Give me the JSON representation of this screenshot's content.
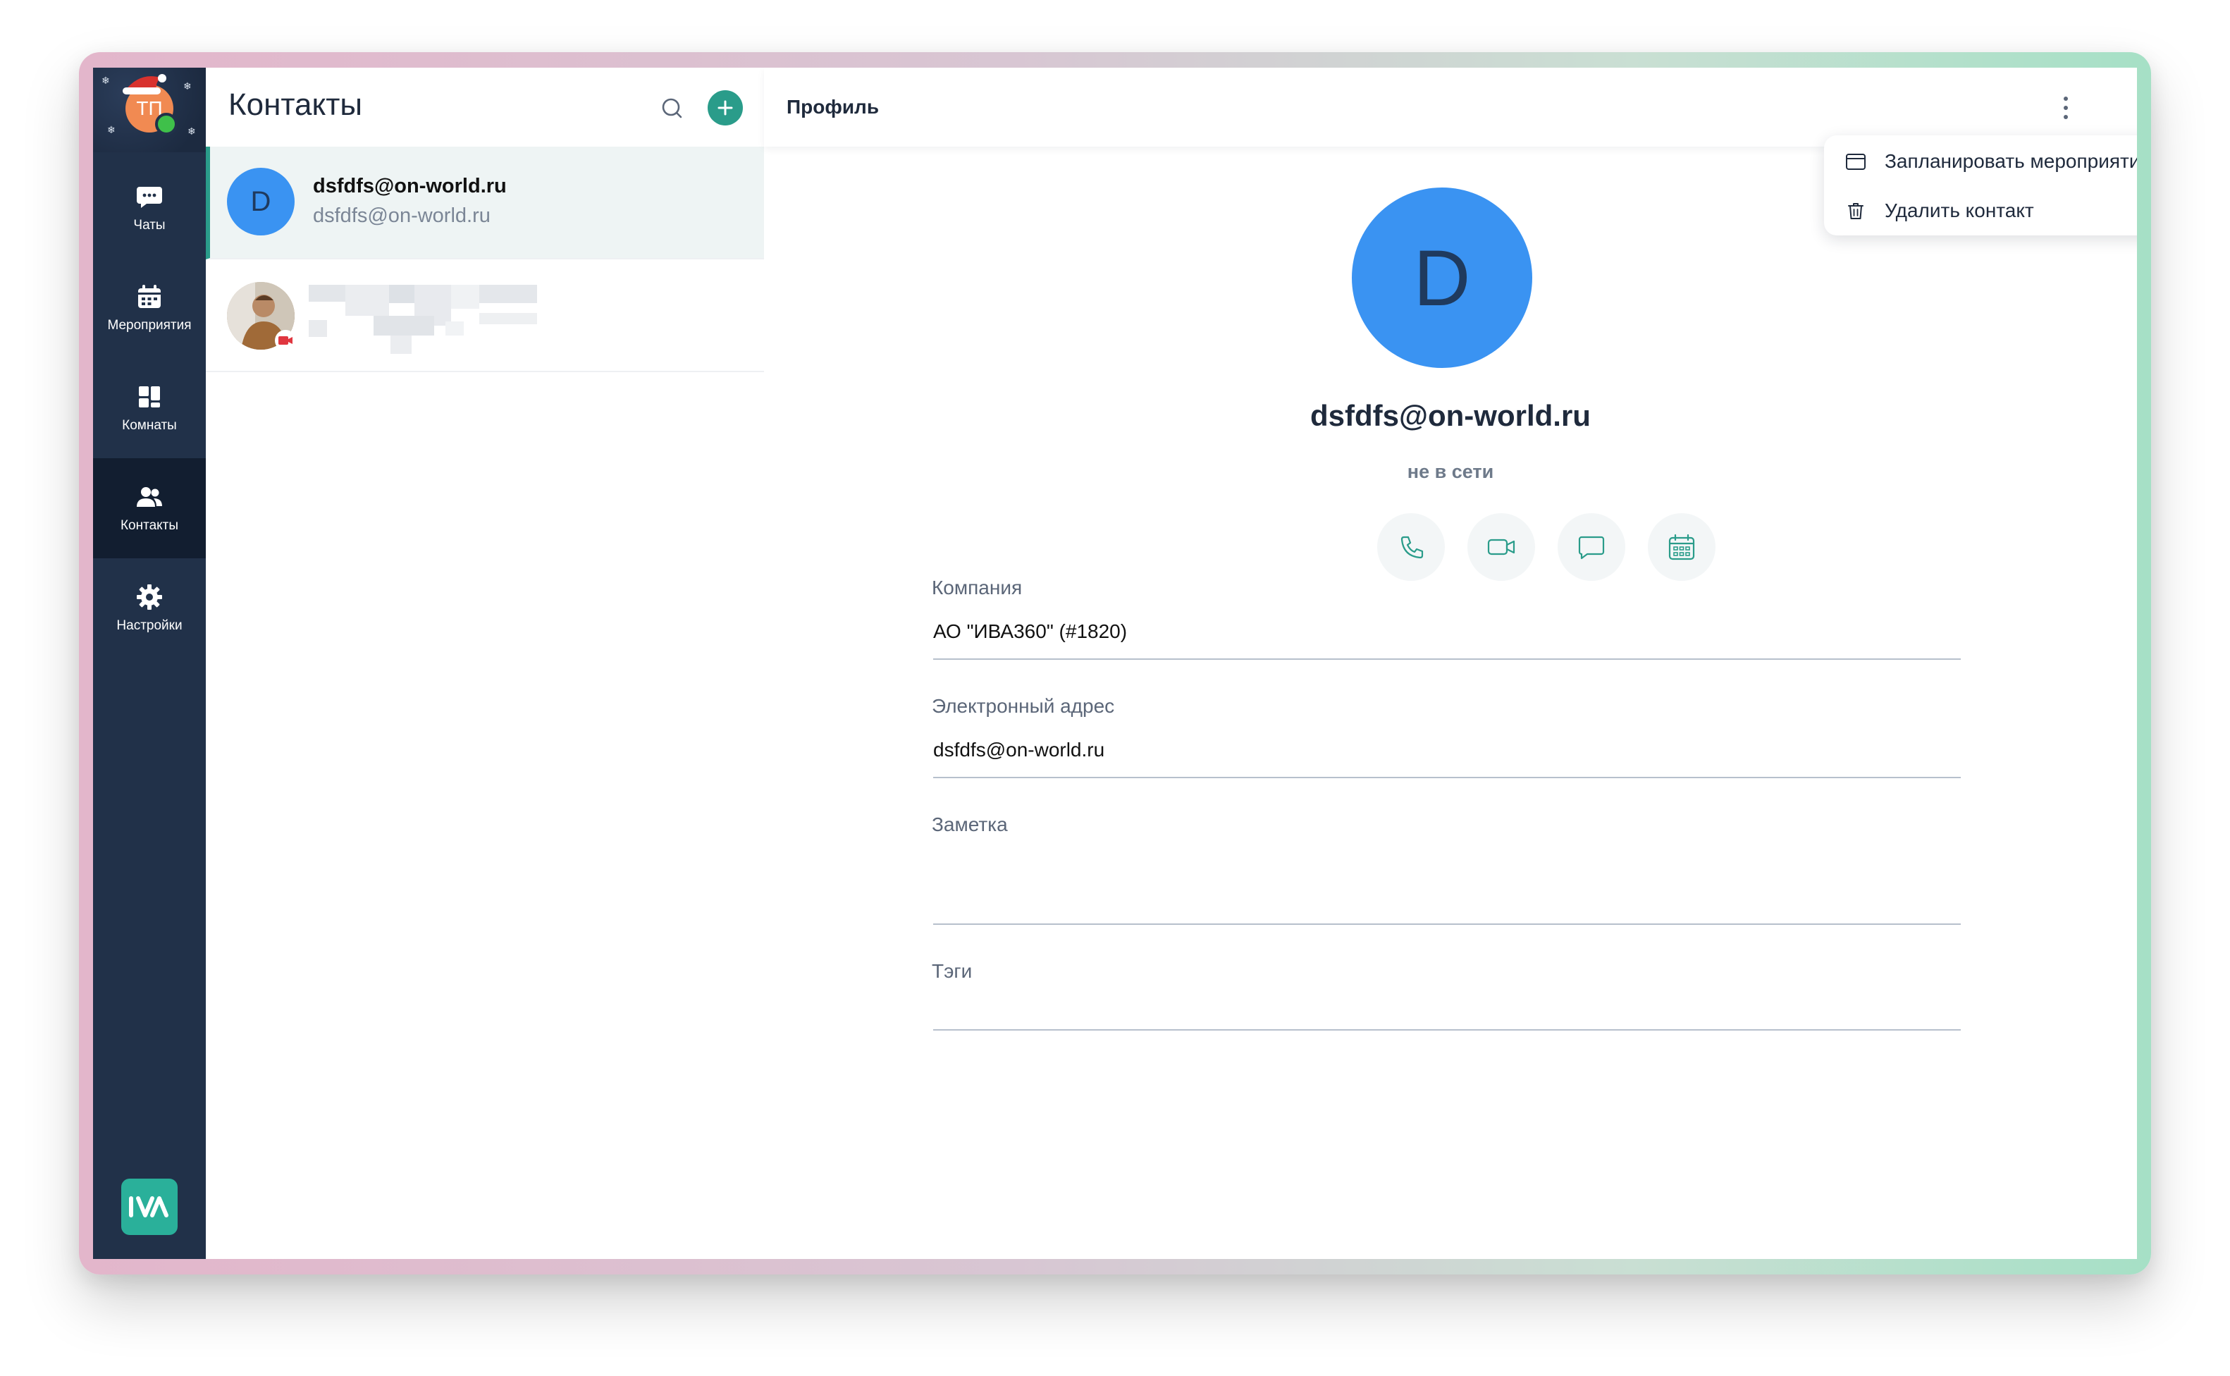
{
  "app": {
    "user_initials": "ТП",
    "accent_color": "#2a9c8a",
    "sidebar_color": "#213149"
  },
  "sidebar": {
    "items": [
      {
        "label": "Чаты",
        "icon": "chat-icon"
      },
      {
        "label": "Мероприятия",
        "icon": "calendar-icon"
      },
      {
        "label": "Комнаты",
        "icon": "rooms-icon"
      },
      {
        "label": "Контакты",
        "icon": "contacts-icon",
        "active": true
      },
      {
        "label": "Настройки",
        "icon": "gear-icon"
      }
    ],
    "logo_icon": "iva-logo-icon"
  },
  "contacts": {
    "title": "Контакты",
    "list": [
      {
        "avatar_letter": "D",
        "name": "dsfdfs@on-world.ru",
        "subtitle": "dsfdfs@on-world.ru",
        "selected": true
      },
      {
        "avatar_type": "photo",
        "name": "",
        "subtitle": "",
        "badge_icon": "camera-icon",
        "blurred": true
      }
    ]
  },
  "profile": {
    "header_title": "Профиль",
    "avatar_letter": "D",
    "name": "dsfdfs@on-world.ru",
    "status": "не в сети",
    "actions": [
      "phone-icon",
      "video-icon",
      "message-icon",
      "calendar-grid-icon"
    ],
    "fields": {
      "company_label": "Компания",
      "company_value": "АО \"ИВА360\" (#1820)",
      "email_label": "Электронный адрес",
      "email_value": "dsfdfs@on-world.ru",
      "note_label": "Заметка",
      "note_value": "",
      "tags_label": "Тэги",
      "tags_value": ""
    }
  },
  "menu": {
    "items": [
      {
        "label": "Запланировать мероприятие",
        "icon": "calendar-outline-icon"
      },
      {
        "label": "Удалить контакт",
        "icon": "trash-icon"
      }
    ]
  }
}
